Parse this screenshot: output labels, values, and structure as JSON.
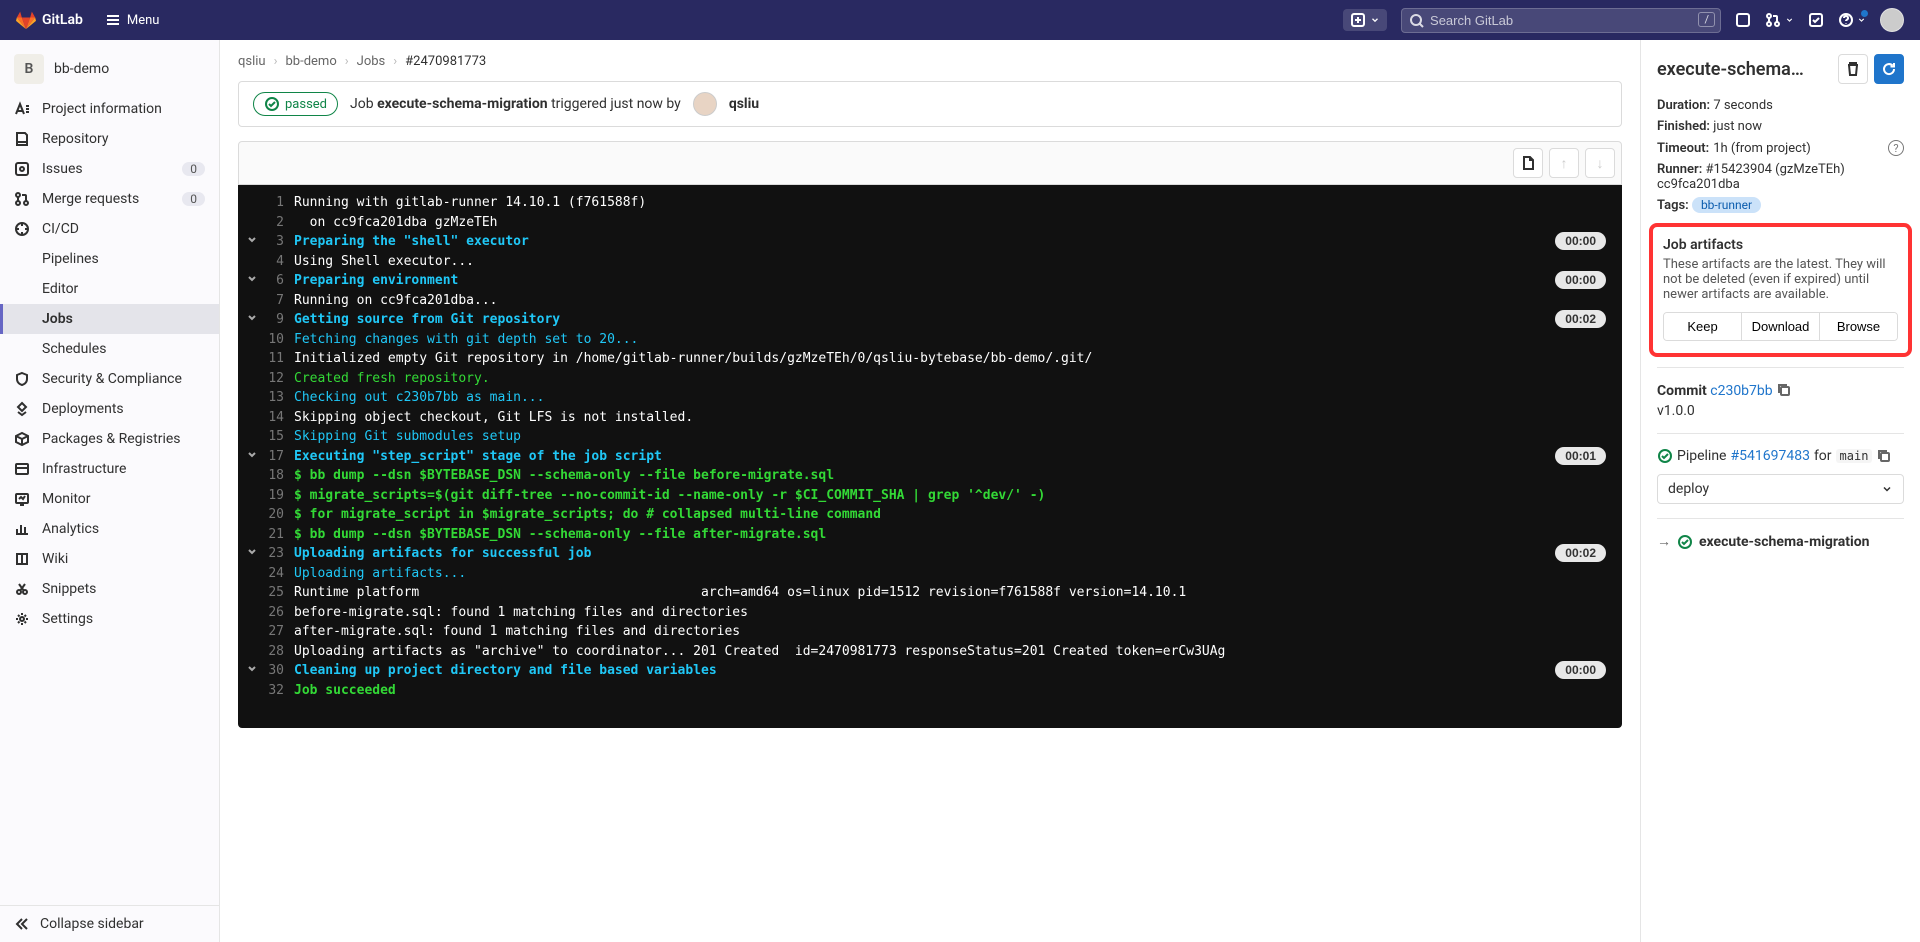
{
  "brand": "GitLab",
  "menu_label": "Menu",
  "search": {
    "placeholder": "Search GitLab",
    "kbd": "/"
  },
  "project": {
    "initial": "B",
    "name": "bb-demo"
  },
  "sidebar": {
    "items": [
      {
        "label": "Project information"
      },
      {
        "label": "Repository"
      },
      {
        "label": "Issues",
        "count": "0"
      },
      {
        "label": "Merge requests",
        "count": "0"
      },
      {
        "label": "CI/CD",
        "sub": [
          {
            "label": "Pipelines"
          },
          {
            "label": "Editor"
          },
          {
            "label": "Jobs",
            "active": true
          },
          {
            "label": "Schedules"
          }
        ]
      },
      {
        "label": "Security & Compliance"
      },
      {
        "label": "Deployments"
      },
      {
        "label": "Packages & Registries"
      },
      {
        "label": "Infrastructure"
      },
      {
        "label": "Monitor"
      },
      {
        "label": "Analytics"
      },
      {
        "label": "Wiki"
      },
      {
        "label": "Snippets"
      },
      {
        "label": "Settings"
      }
    ],
    "collapse": "Collapse sidebar"
  },
  "breadcrumbs": [
    "qsliu",
    "bb-demo",
    "Jobs",
    "#2470981773"
  ],
  "job": {
    "status": "passed",
    "prefix": "Job",
    "name": "execute-schema-migration",
    "trigger_text": "triggered just now by",
    "user": "qsliu"
  },
  "log": [
    {
      "n": "1",
      "cls": "c-white",
      "text": "Running with gitlab-runner 14.10.1 (f761588f)"
    },
    {
      "n": "2",
      "cls": "c-white",
      "text": "  on cc9fca201dba gzMzeTEh"
    },
    {
      "n": "3",
      "cls": "c-cyan-b",
      "text": "Preparing the \"shell\" executor",
      "collapser": true,
      "dur": "00:00"
    },
    {
      "n": "4",
      "cls": "c-white",
      "text": "Using Shell executor..."
    },
    {
      "n": "6",
      "cls": "c-cyan-b",
      "text": "Preparing environment",
      "collapser": true,
      "dur": "00:00"
    },
    {
      "n": "7",
      "cls": "c-white",
      "text": "Running on cc9fca201dba..."
    },
    {
      "n": "9",
      "cls": "c-cyan-b",
      "text": "Getting source from Git repository",
      "collapser": true,
      "dur": "00:02"
    },
    {
      "n": "10",
      "cls": "c-cyan",
      "text": "Fetching changes with git depth set to 20..."
    },
    {
      "n": "11",
      "cls": "c-white",
      "text": "Initialized empty Git repository in /home/gitlab-runner/builds/gzMzeTEh/0/qsliu-bytebase/bb-demo/.git/"
    },
    {
      "n": "12",
      "cls": "c-green",
      "text": "Created fresh repository."
    },
    {
      "n": "13",
      "cls": "c-cyan",
      "text": "Checking out c230b7bb as main..."
    },
    {
      "n": "14",
      "cls": "c-white",
      "text": "Skipping object checkout, Git LFS is not installed."
    },
    {
      "n": "15",
      "cls": "c-cyan",
      "text": "Skipping Git submodules setup"
    },
    {
      "n": "17",
      "cls": "c-cyan-b",
      "text": "Executing \"step_script\" stage of the job script",
      "collapser": true,
      "dur": "00:01"
    },
    {
      "n": "18",
      "cls": "c-green-b",
      "text": "$ bb dump --dsn $BYTEBASE_DSN --schema-only --file before-migrate.sql"
    },
    {
      "n": "19",
      "cls": "c-green-b",
      "text": "$ migrate_scripts=$(git diff-tree --no-commit-id --name-only -r $CI_COMMIT_SHA | grep '^dev/' -)"
    },
    {
      "n": "20",
      "cls": "c-green-b",
      "text": "$ for migrate_script in $migrate_scripts; do # collapsed multi-line command"
    },
    {
      "n": "21",
      "cls": "c-green-b",
      "text": "$ bb dump --dsn $BYTEBASE_DSN --schema-only --file after-migrate.sql"
    },
    {
      "n": "23",
      "cls": "c-cyan-b",
      "text": "Uploading artifacts for successful job",
      "collapser": true,
      "dur": "00:02"
    },
    {
      "n": "24",
      "cls": "c-cyan",
      "text": "Uploading artifacts..."
    },
    {
      "n": "25",
      "cls": "c-white",
      "text": "Runtime platform                                    arch=amd64 os=linux pid=1512 revision=f761588f version=14.10.1"
    },
    {
      "n": "26",
      "cls": "c-white",
      "text": "before-migrate.sql: found 1 matching files and directories "
    },
    {
      "n": "27",
      "cls": "c-white",
      "text": "after-migrate.sql: found 1 matching files and directories "
    },
    {
      "n": "28",
      "cls": "c-white",
      "text": "Uploading artifacts as \"archive\" to coordinator... 201 Created  id=2470981773 responseStatus=201 Created token=erCw3UAg"
    },
    {
      "n": "30",
      "cls": "c-cyan-b",
      "text": "Cleaning up project directory and file based variables",
      "collapser": true,
      "dur": "00:00"
    },
    {
      "n": "32",
      "cls": "c-green-b",
      "text": "Job succeeded"
    }
  ],
  "detail": {
    "title": "execute-schema…",
    "duration_label": "Duration:",
    "duration": "7 seconds",
    "finished_label": "Finished:",
    "finished": "just now",
    "timeout_label": "Timeout:",
    "timeout": "1h (from project)",
    "runner_label": "Runner:",
    "runner": "#15423904 (gzMzeTEh) cc9fca201dba",
    "tags_label": "Tags:",
    "tag": "bb-runner",
    "artifacts_title": "Job artifacts",
    "artifacts_text": "These artifacts are the latest. They will not be deleted (even if expired) until newer artifacts are available.",
    "keep": "Keep",
    "download": "Download",
    "browse": "Browse",
    "commit_label": "Commit",
    "commit": "c230b7bb",
    "commit_ref": "v1.0.0",
    "pipeline_label": "Pipeline",
    "pipeline": "#541697483",
    "pipeline_for": "for",
    "pipeline_branch": "main",
    "stage": "deploy",
    "stage_job": "execute-schema-migration"
  }
}
